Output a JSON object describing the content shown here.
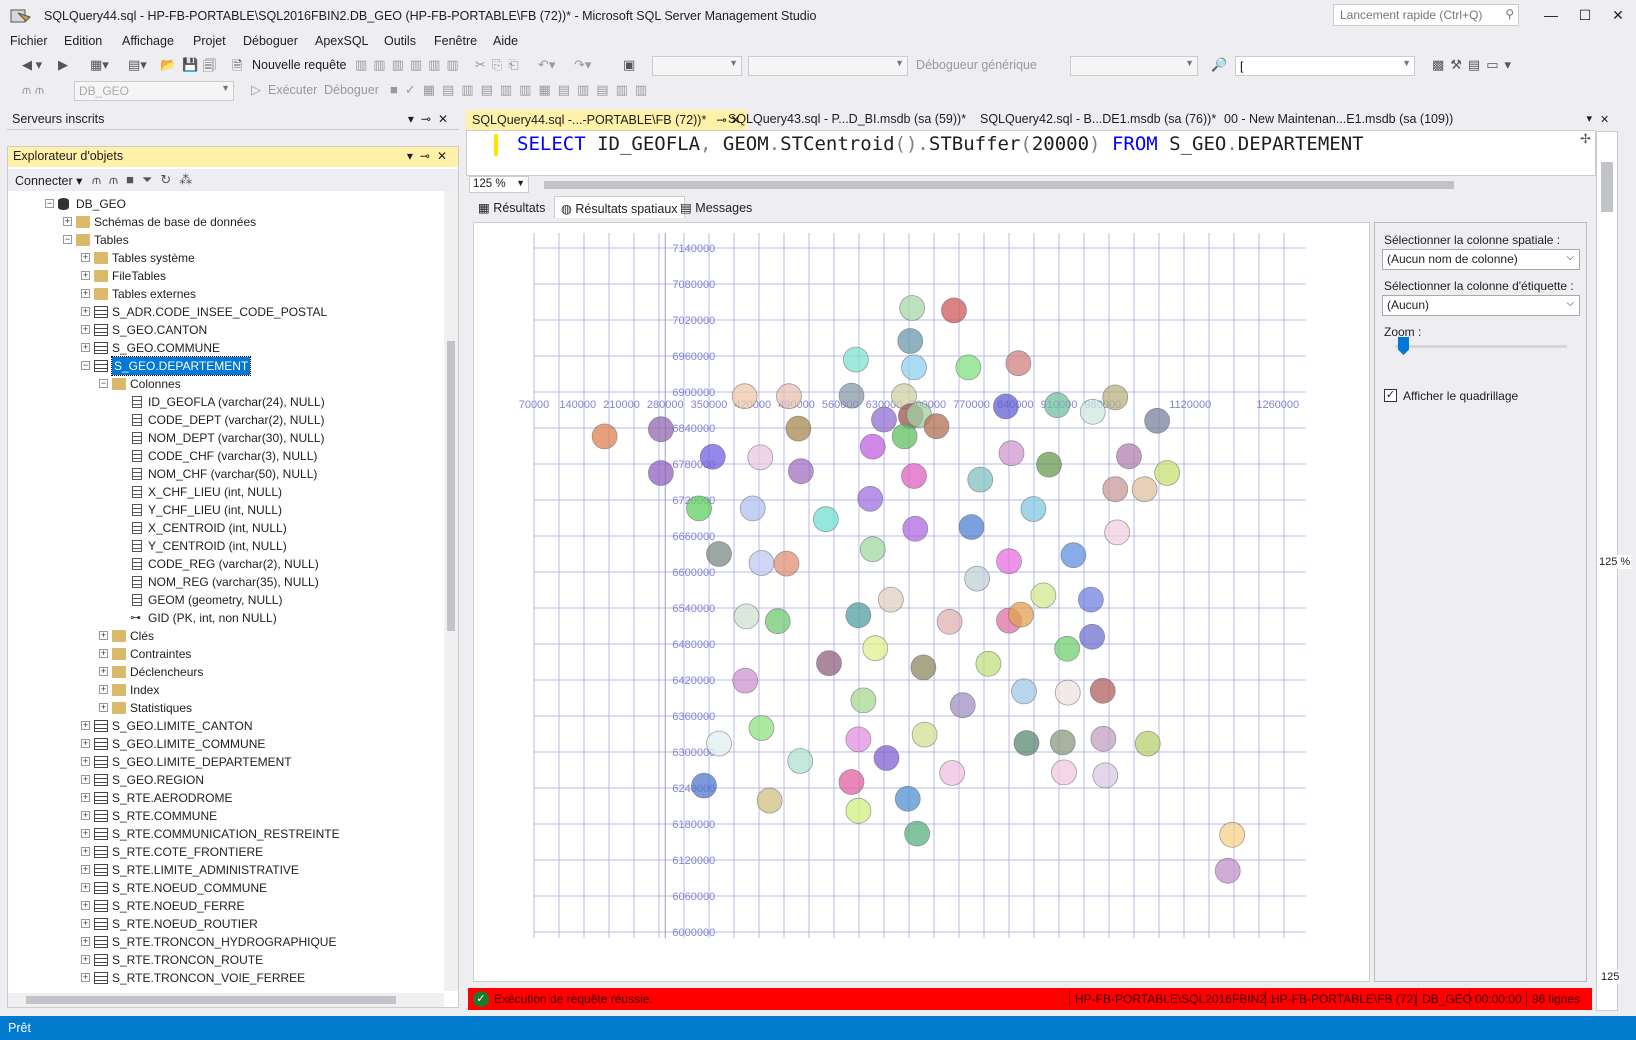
{
  "window": {
    "title": "SQLQuery44.sql - HP-FB-PORTABLE\\SQL2016FBIN2.DB_GEO (HP-FB-PORTABLE\\FB (72))* - Microsoft SQL Server Management Studio",
    "quick_launch_placeholder": "Lancement rapide (Ctrl+Q)"
  },
  "menu": [
    "Fichier",
    "Edition",
    "Affichage",
    "Projet",
    "Déboguer",
    "ApexSQL",
    "Outils",
    "Fenêtre",
    "Aide"
  ],
  "toolbar": {
    "new_query": "Nouvelle requête",
    "debugger_generic": "Débogueur générique",
    "database_combo": "DB_GEO",
    "execute": "Exécuter",
    "debug": "Déboguer",
    "find_value": "["
  },
  "registered_servers": {
    "title": "Serveurs inscrits"
  },
  "object_explorer": {
    "title": "Explorateur d'objets",
    "connect_label": "Connecter ▾",
    "tree": [
      {
        "level": 0,
        "icon": "db",
        "label": "DB_GEO",
        "exp": "-"
      },
      {
        "level": 1,
        "icon": "folder",
        "label": "Schémas de base de données",
        "exp": "+"
      },
      {
        "level": 1,
        "icon": "folder",
        "label": "Tables",
        "exp": "-"
      },
      {
        "level": 2,
        "icon": "folder",
        "label": "Tables système",
        "exp": "+"
      },
      {
        "level": 2,
        "icon": "folder",
        "label": "FileTables",
        "exp": "+"
      },
      {
        "level": 2,
        "icon": "folder",
        "label": "Tables externes",
        "exp": "+"
      },
      {
        "level": 2,
        "icon": "table",
        "label": "S_ADR.CODE_INSEE_CODE_POSTAL",
        "exp": "+"
      },
      {
        "level": 2,
        "icon": "table",
        "label": "S_GEO.CANTON",
        "exp": "+"
      },
      {
        "level": 2,
        "icon": "table",
        "label": "S_GEO.COMMUNE",
        "exp": "+"
      },
      {
        "level": 2,
        "icon": "table",
        "label": "S_GEO.DEPARTEMENT",
        "exp": "-",
        "selected": true
      },
      {
        "level": 3,
        "icon": "folder",
        "label": "Colonnes",
        "exp": "-"
      },
      {
        "level": 4,
        "icon": "column",
        "label": "ID_GEOFLA (varchar(24), NULL)"
      },
      {
        "level": 4,
        "icon": "column",
        "label": "CODE_DEPT (varchar(2), NULL)"
      },
      {
        "level": 4,
        "icon": "column",
        "label": "NOM_DEPT (varchar(30), NULL)"
      },
      {
        "level": 4,
        "icon": "column",
        "label": "CODE_CHF (varchar(3), NULL)"
      },
      {
        "level": 4,
        "icon": "column",
        "label": "NOM_CHF (varchar(50), NULL)"
      },
      {
        "level": 4,
        "icon": "column",
        "label": "X_CHF_LIEU (int, NULL)"
      },
      {
        "level": 4,
        "icon": "column",
        "label": "Y_CHF_LIEU (int, NULL)"
      },
      {
        "level": 4,
        "icon": "column",
        "label": "X_CENTROID (int, NULL)"
      },
      {
        "level": 4,
        "icon": "column",
        "label": "Y_CENTROID (int, NULL)"
      },
      {
        "level": 4,
        "icon": "column",
        "label": "CODE_REG (varchar(2), NULL)"
      },
      {
        "level": 4,
        "icon": "column",
        "label": "NOM_REG (varchar(35), NULL)"
      },
      {
        "level": 4,
        "icon": "column",
        "label": "GEOM (geometry, NULL)"
      },
      {
        "level": 4,
        "icon": "key",
        "label": "GID (PK, int, non NULL)"
      },
      {
        "level": 3,
        "icon": "folder",
        "label": "Clés",
        "exp": "+"
      },
      {
        "level": 3,
        "icon": "folder",
        "label": "Contraintes",
        "exp": "+"
      },
      {
        "level": 3,
        "icon": "folder",
        "label": "Déclencheurs",
        "exp": "+"
      },
      {
        "level": 3,
        "icon": "folder",
        "label": "Index",
        "exp": "+"
      },
      {
        "level": 3,
        "icon": "folder",
        "label": "Statistiques",
        "exp": "+"
      },
      {
        "level": 2,
        "icon": "table",
        "label": "S_GEO.LIMITE_CANTON",
        "exp": "+"
      },
      {
        "level": 2,
        "icon": "table",
        "label": "S_GEO.LIMITE_COMMUNE",
        "exp": "+"
      },
      {
        "level": 2,
        "icon": "table",
        "label": "S_GEO.LIMITE_DEPARTEMENT",
        "exp": "+"
      },
      {
        "level": 2,
        "icon": "table",
        "label": "S_GEO.REGION",
        "exp": "+"
      },
      {
        "level": 2,
        "icon": "table",
        "label": "S_RTE.AERODROME",
        "exp": "+"
      },
      {
        "level": 2,
        "icon": "table",
        "label": "S_RTE.COMMUNE",
        "exp": "+"
      },
      {
        "level": 2,
        "icon": "table",
        "label": "S_RTE.COMMUNICATION_RESTREINTE",
        "exp": "+"
      },
      {
        "level": 2,
        "icon": "table",
        "label": "S_RTE.COTE_FRONTIERE",
        "exp": "+"
      },
      {
        "level": 2,
        "icon": "table",
        "label": "S_RTE.LIMITE_ADMINISTRATIVE",
        "exp": "+"
      },
      {
        "level": 2,
        "icon": "table",
        "label": "S_RTE.NOEUD_COMMUNE",
        "exp": "+"
      },
      {
        "level": 2,
        "icon": "table",
        "label": "S_RTE.NOEUD_FERRE",
        "exp": "+"
      },
      {
        "level": 2,
        "icon": "table",
        "label": "S_RTE.NOEUD_ROUTIER",
        "exp": "+"
      },
      {
        "level": 2,
        "icon": "table",
        "label": "S_RTE.TRONCON_HYDROGRAPHIQUE",
        "exp": "+"
      },
      {
        "level": 2,
        "icon": "table",
        "label": "S_RTE.TRONCON_ROUTE",
        "exp": "+"
      },
      {
        "level": 2,
        "icon": "table",
        "label": "S_RTE.TRONCON_VOIE_FERREE",
        "exp": "+"
      }
    ]
  },
  "doc_tabs": [
    {
      "label": "SQLQuery44.sql -...-PORTABLE\\FB (72))*",
      "active": true,
      "pin": "⊸ ✕"
    },
    {
      "label": "SQLQuery43.sql - P...D_BI.msdb (sa (59))*",
      "active": false
    },
    {
      "label": "SQLQuery42.sql - B...DE1.msdb (sa (76))*",
      "active": false
    },
    {
      "label": "00 - New Maintenan...E1.msdb (sa (109))",
      "active": false
    }
  ],
  "editor": {
    "sql_tokens": [
      {
        "t": "SELECT",
        "c": "kw"
      },
      {
        "t": " ID_GEOFLA",
        "c": ""
      },
      {
        "t": ",",
        "c": "punc"
      },
      {
        "t": " GEOM",
        "c": ""
      },
      {
        "t": ".",
        "c": "punc"
      },
      {
        "t": "STCentroid",
        "c": ""
      },
      {
        "t": "()",
        "c": "punc"
      },
      {
        "t": ".",
        "c": "punc"
      },
      {
        "t": "STBuffer",
        "c": ""
      },
      {
        "t": "(",
        "c": "punc"
      },
      {
        "t": "20000",
        "c": ""
      },
      {
        "t": ")",
        "c": "punc"
      },
      {
        "t": " FROM",
        "c": "kw"
      },
      {
        "t": " S_GEO",
        "c": ""
      },
      {
        "t": ".",
        "c": "punc"
      },
      {
        "t": "DEPARTEMENT",
        "c": ""
      }
    ],
    "zoom": "125 %"
  },
  "result_tabs": [
    {
      "label": "Résultats",
      "icon": "grid-icon"
    },
    {
      "label": "Résultats spatiaux",
      "icon": "globe-icon",
      "active": true
    },
    {
      "label": "Messages",
      "icon": "messages-icon"
    }
  ],
  "spatial_options": {
    "spatial_column_label": "Sélectionner la colonne spatiale :",
    "spatial_column_value": "(Aucun nom de colonne)",
    "label_column_label": "Sélectionner la colonne d'étiquette :",
    "label_column_value": "(Aucun)",
    "zoom_label": "Zoom :",
    "zoom_level": 0.02,
    "show_grid_label": "Afficher le quadrillage",
    "show_grid": true
  },
  "chart_data": {
    "type": "scatter",
    "grid": true,
    "x_ticks": [
      "70000",
      "140000",
      "210000",
      "280000",
      "350000",
      "420000",
      "490000",
      "560000",
      "630000",
      "700000",
      "770000",
      "840000",
      "910000",
      "980000",
      "1120000",
      "1260000"
    ],
    "y_ticks": [
      "7140000",
      "7080000",
      "7020000",
      "6960000",
      "6900000",
      "6840000",
      "6780000",
      "6720000",
      "6660000",
      "6600000",
      "6540000",
      "6480000",
      "6420000",
      "6360000",
      "6300000",
      "6240000",
      "6180000",
      "6120000",
      "6060000",
      "6000000"
    ],
    "xlim": [
      70000,
      1260000
    ],
    "ylim": [
      6000000,
      7140000
    ],
    "buffer_radius": 20000,
    "points": [
      [
        675000,
        7040000,
        "#a8d8a8"
      ],
      [
        742000,
        7036000,
        "#d05858"
      ],
      [
        672000,
        6985000,
        "#6a98a8"
      ],
      [
        585000,
        6954000,
        "#80e0d0"
      ],
      [
        678000,
        6941000,
        "#90d0f0"
      ],
      [
        765000,
        6941000,
        "#80e080"
      ],
      [
        845000,
        6948000,
        "#d08080"
      ],
      [
        407000,
        6893000,
        "#f0c8a8"
      ],
      [
        478000,
        6893000,
        "#e8c0b0"
      ],
      [
        578000,
        6894000,
        "#8898a8"
      ],
      [
        662000,
        6893000,
        "#d0d0a0"
      ],
      [
        825000,
        6876000,
        "#6060d0"
      ],
      [
        907000,
        6878000,
        "#70c0a0"
      ],
      [
        964000,
        6867000,
        "#d0e8e0"
      ],
      [
        1000000,
        6891000,
        "#b8b080"
      ],
      [
        1067000,
        6852000,
        "#7880a0"
      ],
      [
        183000,
        6826000,
        "#e08050"
      ],
      [
        273000,
        6838000,
        "#9068b0"
      ],
      [
        493000,
        6839000,
        "#a88850"
      ],
      [
        630000,
        6854000,
        "#9070d0"
      ],
      [
        673000,
        6860000,
        "#a05050"
      ],
      [
        686000,
        6862000,
        "#a0d0a0"
      ],
      [
        714000,
        6843000,
        "#b07050"
      ],
      [
        663000,
        6826000,
        "#60c060"
      ],
      [
        612000,
        6809000,
        "#c060e0"
      ],
      [
        834000,
        6798000,
        "#d098d0"
      ],
      [
        1022000,
        6793000,
        "#b080b0"
      ],
      [
        356000,
        6792000,
        "#7060e0"
      ],
      [
        432000,
        6791000,
        "#e8c8e0"
      ],
      [
        497000,
        6768000,
        "#a070c0"
      ],
      [
        894000,
        6779000,
        "#6a9a50"
      ],
      [
        273000,
        6765000,
        "#9060c0"
      ],
      [
        678000,
        6760000,
        "#e060c0"
      ],
      [
        784000,
        6754000,
        "#80c0c0"
      ],
      [
        1083000,
        6765000,
        "#c8e070"
      ],
      [
        1000000,
        6738000,
        "#c89898"
      ],
      [
        1047000,
        6738000,
        "#e0c0a0"
      ],
      [
        334000,
        6706000,
        "#60d060"
      ],
      [
        420000,
        6706000,
        "#b0c0f0"
      ],
      [
        608000,
        6722000,
        "#a070e0"
      ],
      [
        869000,
        6705000,
        "#80c8e0"
      ],
      [
        537000,
        6688000,
        "#70e0d0"
      ],
      [
        680000,
        6672000,
        "#b068e0"
      ],
      [
        770000,
        6675000,
        "#5080d0"
      ],
      [
        1003000,
        6666000,
        "#f0d0e0"
      ],
      [
        366000,
        6630000,
        "#7a8a80"
      ],
      [
        434000,
        6615000,
        "#c0c8f0"
      ],
      [
        474000,
        6614000,
        "#e09070"
      ],
      [
        612000,
        6638000,
        "#a0d8a0"
      ],
      [
        830000,
        6618000,
        "#e870e0"
      ],
      [
        933000,
        6628000,
        "#6090e0"
      ],
      [
        779000,
        6589000,
        "#c0d0d8"
      ],
      [
        641000,
        6554000,
        "#e0d0c0"
      ],
      [
        885000,
        6561000,
        "#d0e890"
      ],
      [
        961000,
        6554000,
        "#7080e0"
      ],
      [
        410000,
        6526000,
        "#d0e0d0"
      ],
      [
        460000,
        6518000,
        "#70c870"
      ],
      [
        589000,
        6528000,
        "#50a0a0"
      ],
      [
        735000,
        6517000,
        "#e0b0b0"
      ],
      [
        830000,
        6519000,
        "#e070a0"
      ],
      [
        849000,
        6529000,
        "#e0a050"
      ],
      [
        923000,
        6472000,
        "#70d070"
      ],
      [
        963000,
        6492000,
        "#7070d0"
      ],
      [
        616000,
        6473000,
        "#e0f090"
      ],
      [
        542000,
        6448000,
        "#906080"
      ],
      [
        693000,
        6441000,
        "#8a8a60"
      ],
      [
        797000,
        6447000,
        "#c0e080"
      ],
      [
        408000,
        6419000,
        "#d090d0"
      ],
      [
        854000,
        6401000,
        "#a0c8e8"
      ],
      [
        924000,
        6399000,
        "#f0e0e0"
      ],
      [
        980000,
        6402000,
        "#b06060"
      ],
      [
        597000,
        6386000,
        "#a8d890"
      ],
      [
        756000,
        6378000,
        "#a090c0"
      ],
      [
        434000,
        6340000,
        "#90e080"
      ],
      [
        589000,
        6321000,
        "#e090e0"
      ],
      [
        695000,
        6329000,
        "#d0e090"
      ],
      [
        981000,
        6322000,
        "#c0a0c0"
      ],
      [
        366000,
        6314000,
        "#e0f0f0"
      ],
      [
        858000,
        6315000,
        "#5a8a70"
      ],
      [
        916000,
        6316000,
        "#8a9a80"
      ],
      [
        1052000,
        6314000,
        "#b8d070"
      ],
      [
        496000,
        6285000,
        "#b0e0d0"
      ],
      [
        634000,
        6290000,
        "#8060d0"
      ],
      [
        739000,
        6265000,
        "#f0c0e0"
      ],
      [
        918000,
        6266000,
        "#f0c8e0"
      ],
      [
        984000,
        6261000,
        "#d8c8e0"
      ],
      [
        342000,
        6244000,
        "#5078d0"
      ],
      [
        578000,
        6250000,
        "#e060a0"
      ],
      [
        447000,
        6219000,
        "#d0c080"
      ],
      [
        668000,
        6222000,
        "#5090d0"
      ],
      [
        589000,
        6202000,
        "#d0f080"
      ],
      [
        683000,
        6164000,
        "#5ab080"
      ],
      [
        1187000,
        6162000,
        "#f8d088"
      ],
      [
        1180000,
        6102000,
        "#c090c8"
      ]
    ]
  },
  "query_status": {
    "message": "Exécution de requête réussie.",
    "server": "HP-FB-PORTABLE\\SQL2016FBIN2...",
    "login": "HP-FB-PORTABLE\\FB (72)",
    "database": "DB_GEO",
    "elapsed": "00:00:00",
    "rows": "96 lignes"
  },
  "app_status": "Prêt",
  "right_strip": {
    "zoom_a": "125 %",
    "zoom_b": "125"
  }
}
